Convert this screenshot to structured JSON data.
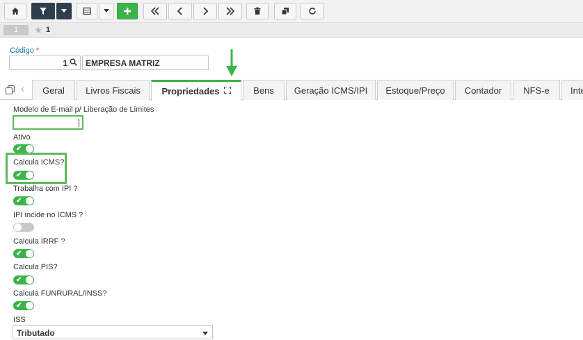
{
  "toolbar": {
    "buttons": [
      {
        "name": "home-button",
        "icon": "home-icon"
      },
      {
        "name": "filter-button",
        "icon": "filter-icon"
      },
      {
        "name": "filter-dropdown-button",
        "icon": "caret-down-icon"
      },
      {
        "name": "list-view-button",
        "icon": "list-icon"
      },
      {
        "name": "list-view-dropdown-button",
        "icon": "caret-down-icon"
      },
      {
        "name": "add-button",
        "icon": "plus-icon"
      },
      {
        "name": "first-record-button",
        "icon": "double-chevron-left-icon"
      },
      {
        "name": "previous-record-button",
        "icon": "chevron-left-icon"
      },
      {
        "name": "next-record-button",
        "icon": "chevron-right-icon"
      },
      {
        "name": "last-record-button",
        "icon": "double-chevron-right-icon"
      },
      {
        "name": "delete-button",
        "icon": "trash-icon"
      },
      {
        "name": "copy-button",
        "icon": "copy-icon"
      },
      {
        "name": "refresh-button",
        "icon": "refresh-icon"
      }
    ]
  },
  "record_bar": {
    "record_number": "1",
    "favorite_label": "1"
  },
  "header": {
    "codigo_label": "Código",
    "required_mark": "*",
    "codigo_value": "1",
    "empresa_name": "EMPRESA MATRIZ"
  },
  "tabs": [
    {
      "label": "Geral"
    },
    {
      "label": "Livros Fiscais"
    },
    {
      "label": "Propriedades",
      "active": true
    },
    {
      "label": "Bens"
    },
    {
      "label": "Geração ICMS/IPI"
    },
    {
      "label": "Estoque/Preço"
    },
    {
      "label": "Contador"
    },
    {
      "label": "NFS-e"
    },
    {
      "label": "Inte"
    }
  ],
  "form": {
    "email_model_label": "Modelo de E-mail p/ Liberação de Limites",
    "email_model_value": "",
    "toggles": [
      {
        "label": "Ativo",
        "on": true
      },
      {
        "label": "Calcula ICMS?",
        "on": true
      },
      {
        "label": "Trabalha com IPI ?",
        "on": true
      },
      {
        "label": "IPI incide no ICMS ?",
        "on": false
      },
      {
        "label": "Calcula IRRF ?",
        "on": true
      },
      {
        "label": "Calcula PIS?",
        "on": true
      },
      {
        "label": "Calcula FUNRURAL/INSS?",
        "on": true
      }
    ],
    "iss_label": "ISS",
    "iss_value": "Tributado"
  },
  "colors": {
    "accent_green": "#3cb44a",
    "dark_button": "#2f3e4d",
    "label_blue": "#1f6fb5",
    "required_red": "#e12b2b"
  }
}
